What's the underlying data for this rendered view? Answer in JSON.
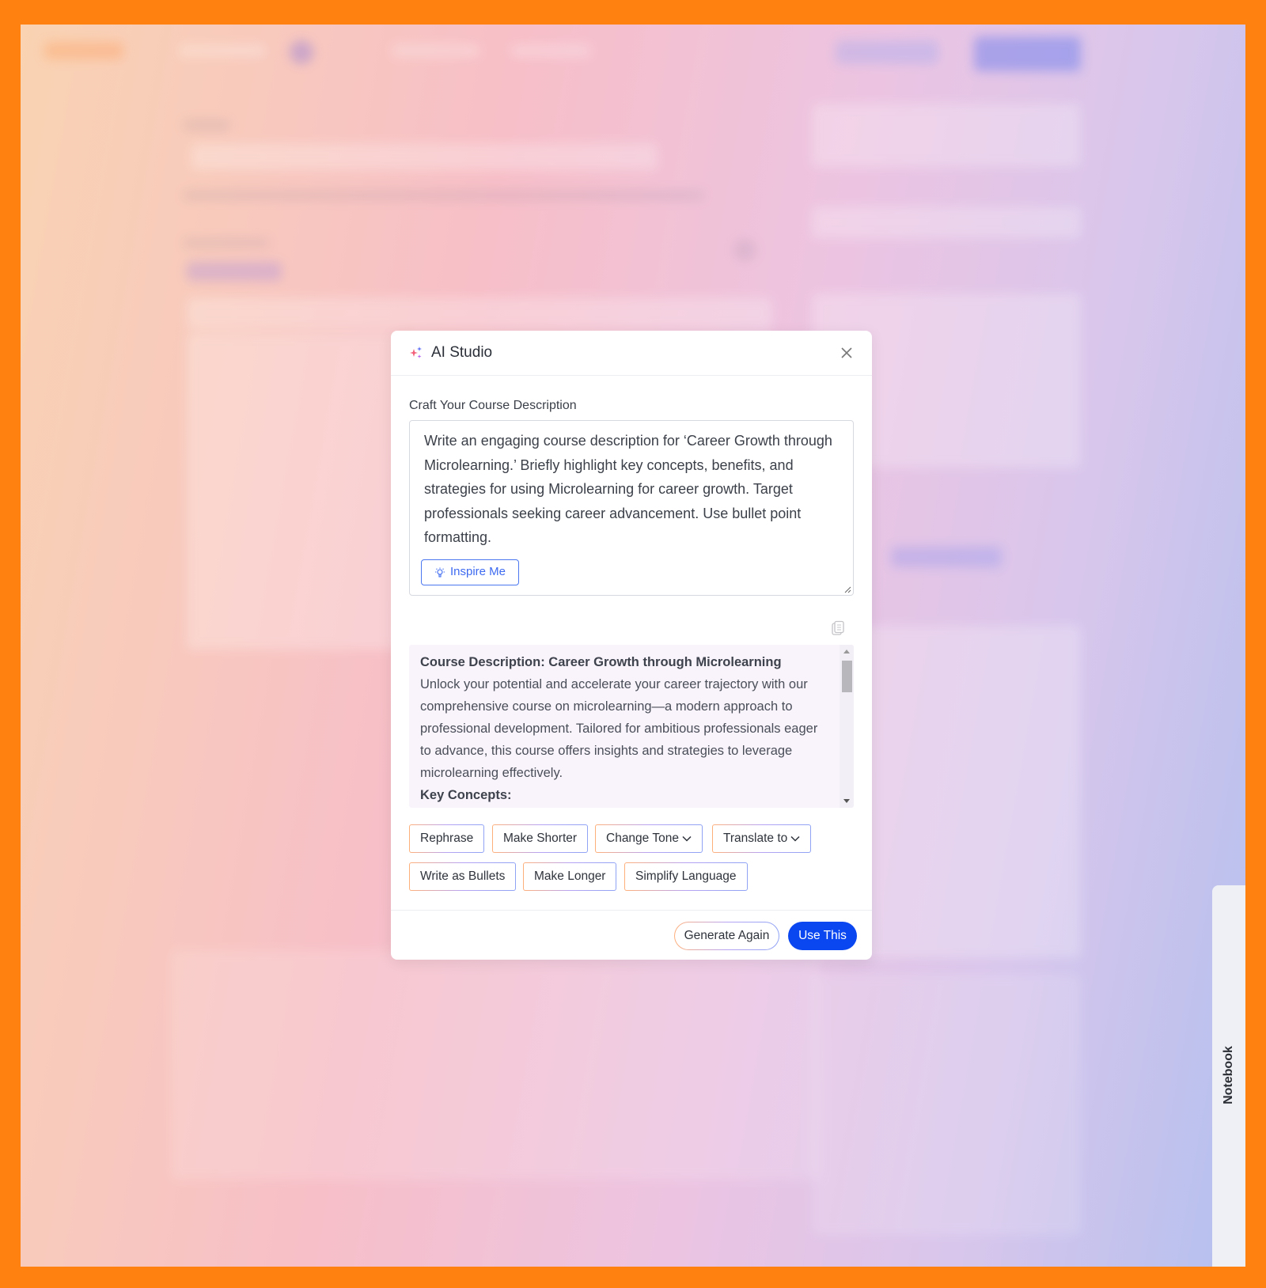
{
  "modal": {
    "title": "AI Studio",
    "prompt_label": "Craft Your Course Description",
    "prompt_value": "Write an engaging course description for ‘Career Growth through Microlearning.’ Briefly highlight key concepts, benefits, and strategies for using Microlearning for career growth. Target professionals seeking career advancement. Use bullet point formatting.",
    "inspire_label": "Inspire Me",
    "output": {
      "heading": "Course Description: Career Growth through Microlearning",
      "body": "Unlock your potential and accelerate your career trajectory with our comprehensive course on microlearning—a modern approach to professional development. Tailored for ambitious professionals eager to advance, this course offers insights and strategies to leverage microlearning effectively.",
      "subheading": "Key Concepts:"
    },
    "actions": [
      "Rephrase",
      "Make Shorter",
      "Change Tone",
      "Translate to",
      "Write as Bullets",
      "Make Longer",
      "Simplify Language"
    ],
    "generate_again_label": "Generate Again",
    "use_this_label": "Use This"
  },
  "notebook_label": "Notebook",
  "colors": {
    "frame": "#ff8210",
    "primary": "#0a47f0",
    "link": "#3d6af0"
  }
}
